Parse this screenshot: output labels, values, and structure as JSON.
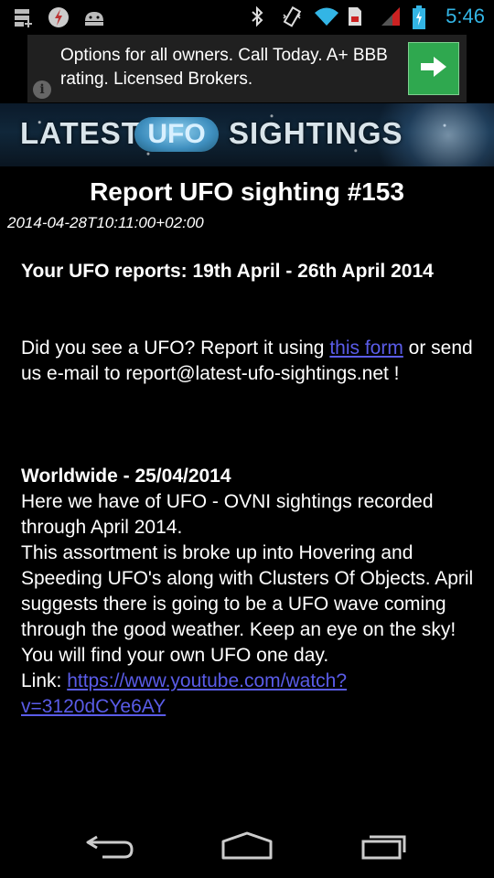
{
  "status_bar": {
    "time": "5:46",
    "left_icons": [
      "storage-icon",
      "flash-icon",
      "android-icon"
    ],
    "right_icons": [
      "bluetooth-icon",
      "vibrate-icon",
      "wifi-icon",
      "sim-icon",
      "signal-icon",
      "battery-icon"
    ]
  },
  "ad": {
    "text": "Options for all owners. Call Today. A+ BBB rating. Licensed Brokers.",
    "info_icon": "info-icon",
    "cta_icon": "arrow-right-icon",
    "cta_color": "#2fa84f"
  },
  "banner": {
    "word_left": "LATEST",
    "word_middle": "UFO",
    "word_right": "SIGHTINGS"
  },
  "article": {
    "title": "Report UFO sighting #153",
    "date": "2014-04-28T10:11:00+02:00",
    "heading": "Your UFO reports: 19th April -  26th April 2014",
    "report_prefix": "Did you see a UFO? Report it using ",
    "report_link": "this form",
    "report_suffix": " or send us e-mail to report@latest-ufo-sightings.net !",
    "section_title": "Worldwide - 25/04/2014",
    "body_1": "Here we have of UFO - OVNI sightings recorded through April 2014.",
    "body_2": "This assortment is broke up into Hovering and Speeding UFO's along with Clusters Of Objects. April suggests there is going to be a UFO wave coming through the good weather. Keep an eye on the sky! You will find your own UFO one day.",
    "link_label": "Link: ",
    "link_url": "https://www.youtube.com/watch?v=3120dCYe6AY",
    "link_color": "#5a5ce8"
  },
  "nav_bar": {
    "icons": [
      "back-icon",
      "home-icon",
      "recent-apps-icon"
    ]
  }
}
